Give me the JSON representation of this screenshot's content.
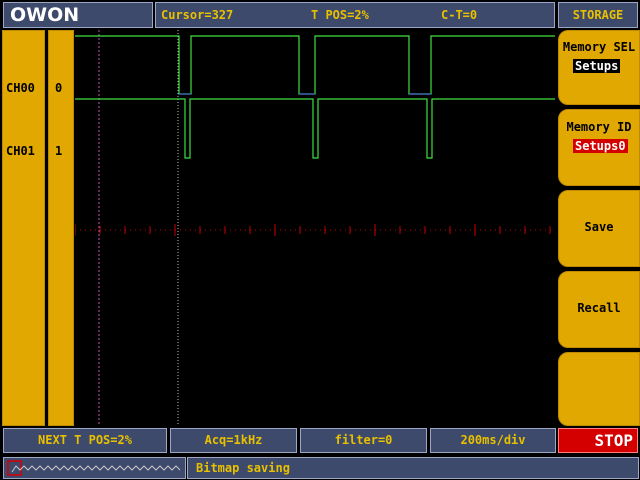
{
  "header": {
    "logo": "OWON",
    "cursor": "Cursor=327",
    "t_pos": "T POS=2%",
    "c_t": "C-T=0",
    "menu_title": "STORAGE"
  },
  "channels": [
    {
      "name": "CH00",
      "num": "0"
    },
    {
      "name": "CH01",
      "num": "1"
    }
  ],
  "menu": {
    "memory_sel": {
      "label": "Memory SEL",
      "value": "Setups"
    },
    "memory_id": {
      "label": "Memory ID",
      "value": "Setups0"
    },
    "save": "Save",
    "recall": "Recall",
    "empty": ""
  },
  "footer": {
    "next_t_pos": "NEXT T POS=2%",
    "acq": "Acq=1kHz",
    "filter": "filter=0",
    "timebase": "200ms/div",
    "stop": "STOP",
    "message": "Bitmap saving"
  },
  "colors": {
    "accent_yellow": "#e0a800",
    "panel_blue": "#3d4a6b",
    "text_yellow": "#e8c000",
    "trace_green": "#40e040",
    "marker_red": "#c00000",
    "stop_red": "#d40000"
  },
  "icons": {
    "mini_waveform": "waveform-icon",
    "trigger_marker": "trigger-marker-icon"
  }
}
